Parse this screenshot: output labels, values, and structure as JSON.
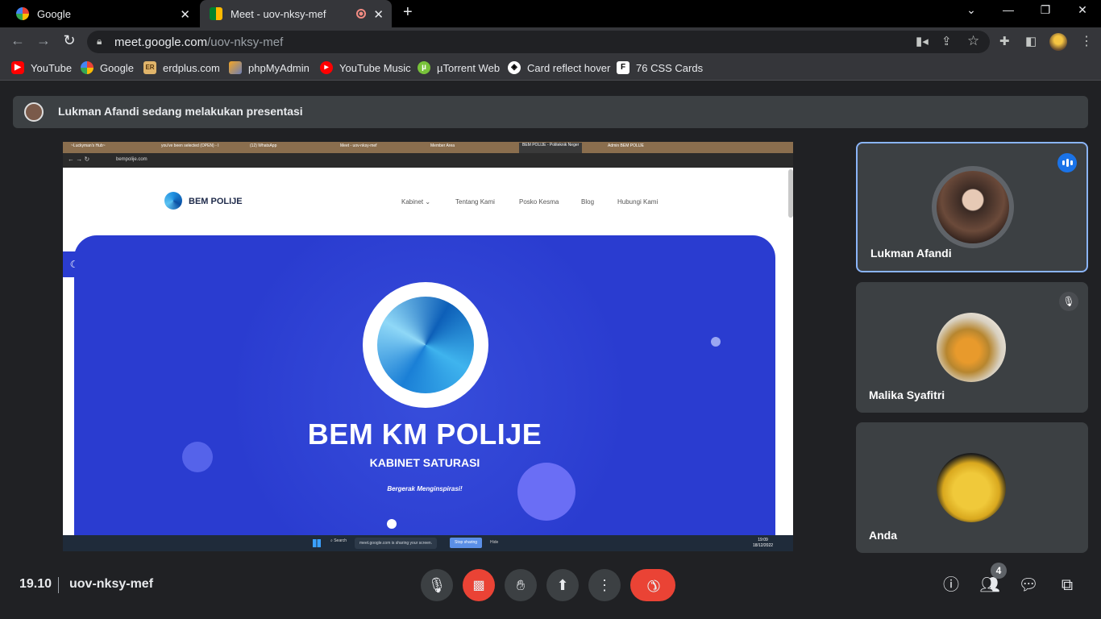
{
  "browser": {
    "tabs": [
      {
        "title": "Google",
        "icon": "google-icon"
      },
      {
        "title": "Meet - uov-nksy-mef",
        "icon": "meet-icon",
        "recording": true
      }
    ],
    "new_tab_label": "+",
    "window_controls": {
      "minimize": "—",
      "restore": "❐",
      "close": "✕",
      "dropdown": "⌄"
    },
    "url_host": "meet.google.com",
    "url_path": "/uov-nksy-mef",
    "bookmarks": [
      "YouTube",
      "Google",
      "erdplus.com",
      "phpMyAdmin",
      "YouTube Music",
      "µTorrent Web",
      "Card reflect hover",
      "76 CSS Cards"
    ],
    "bookmark_erd_icon_text": "ER",
    "bookmark_f_icon_text": "F"
  },
  "meet": {
    "banner_text": "Lukman Afandi sedang melakukan presentasi",
    "meeting_time": "19.10",
    "meeting_code": "uov-nksy-mef",
    "participants": [
      {
        "name": "Lukman Afandi",
        "state": "speaking"
      },
      {
        "name": "Malika Syafitri",
        "state": "muted"
      },
      {
        "name": "Anda",
        "state": "normal"
      }
    ],
    "participant_count": "4",
    "accent": "#8ab4f8",
    "end_call_color": "#ea4335"
  },
  "shared": {
    "inner_tabs": [
      "~Luckyman's Hub~",
      "you've been selected (OPEN) - I",
      "(12) WhatsApp",
      "Meet - uov-nksy-mef",
      "Member Area",
      "BEM POLIJE - Politeknik Neger",
      "Admin BEM POLIJE"
    ],
    "inner_url": "bempolije.com",
    "site_logo": "BEM POLIJE",
    "nav": [
      "Kabinet ⌄",
      "Tentang Kami",
      "Posko Kesma",
      "Blog",
      "Hubungi Kami"
    ],
    "hero_title": "BEM KM POLIJE",
    "hero_subtitle": "KABINET SATURASI",
    "hero_tagline": "Bergerak Menginspirasi!",
    "taskbar_search": "Search",
    "share_notice": "meet.google.com is sharing your screen.",
    "stop_sharing": "Stop sharing",
    "hide": "Hide",
    "clock_time": "19:09",
    "clock_date": "18/12/2022",
    "hero_color": "#2a3cd0"
  }
}
